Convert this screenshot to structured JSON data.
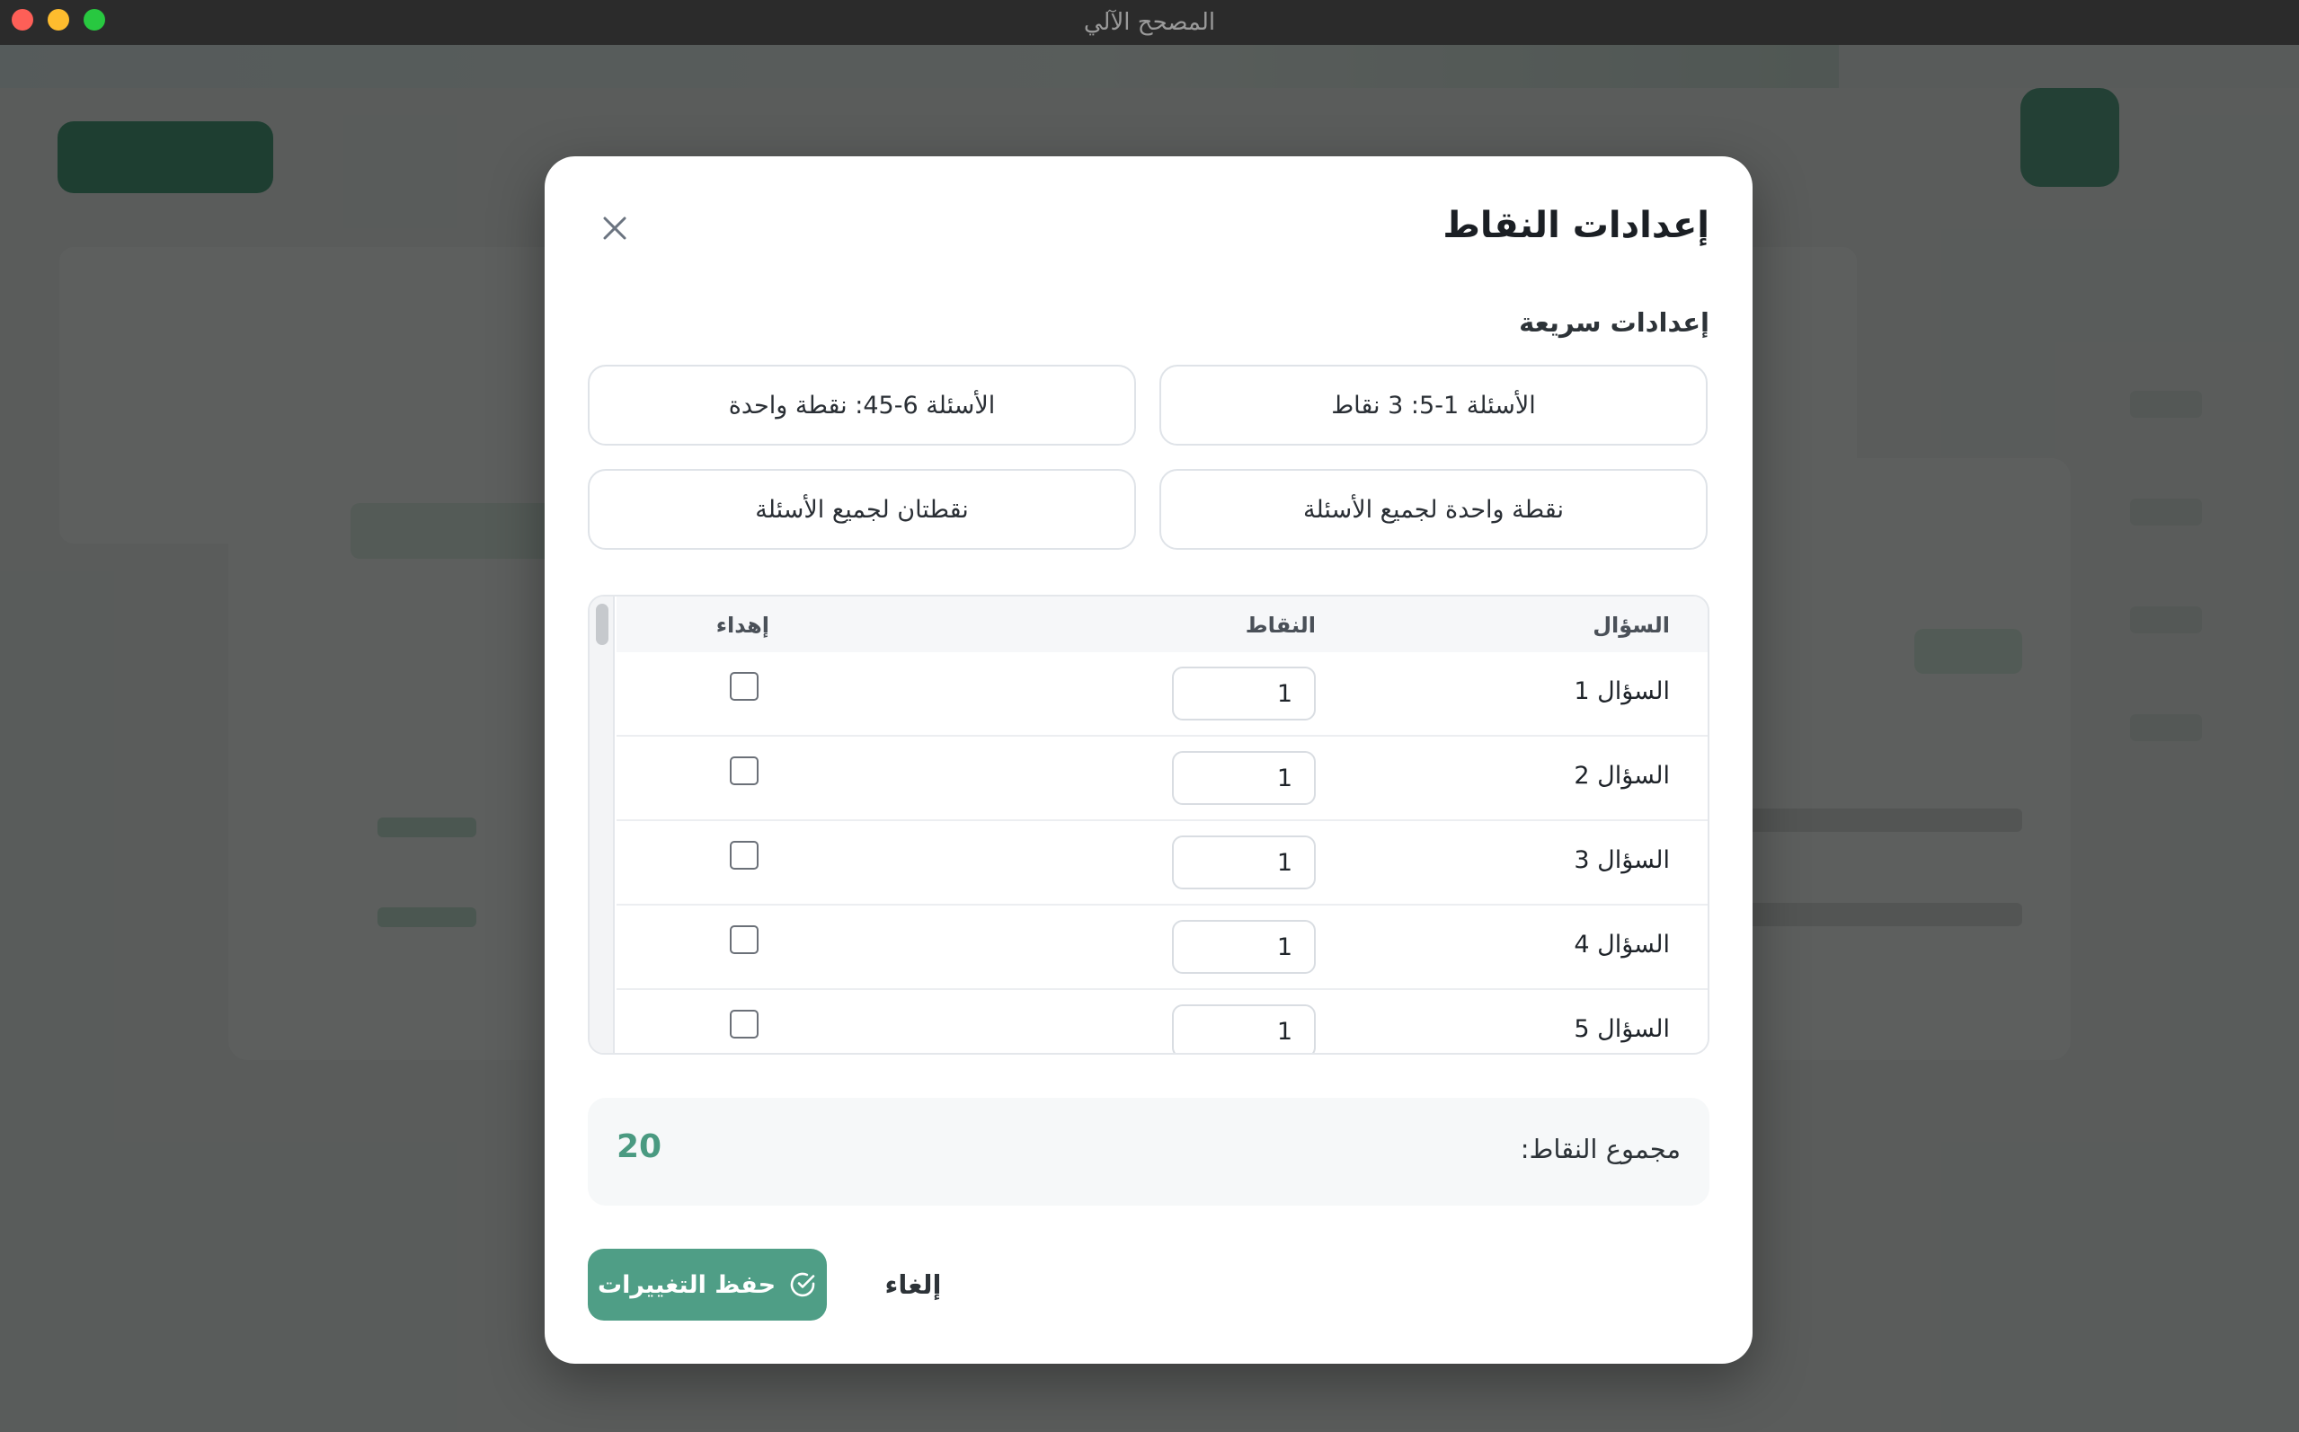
{
  "window": {
    "title": "المصحح الآلي"
  },
  "colors": {
    "accent": "#4f9e86",
    "total": "#4a9a81"
  },
  "modal": {
    "title": "إعدادات النقاط",
    "close_icon": "close-icon",
    "quick_settings": {
      "label": "إعدادات سريعة",
      "options": [
        "الأسئلة 1-5: 3 نقاط",
        "الأسئلة 6-45: نقطة واحدة",
        "نقطة واحدة لجميع الأسئلة",
        "نقطتان لجميع الأسئلة"
      ]
    },
    "table": {
      "headers": {
        "question": "السؤال",
        "points": "النقاط",
        "gift": "إهداء"
      },
      "rows": [
        {
          "question": "السؤال 1",
          "points": "1",
          "gift": false
        },
        {
          "question": "السؤال 2",
          "points": "1",
          "gift": false
        },
        {
          "question": "السؤال 3",
          "points": "1",
          "gift": false
        },
        {
          "question": "السؤال 4",
          "points": "1",
          "gift": false
        },
        {
          "question": "السؤال 5",
          "points": "1",
          "gift": false
        }
      ]
    },
    "total": {
      "label": "مجموع النقاط:",
      "value": "20"
    },
    "buttons": {
      "save": "حفظ التغييرات",
      "save_icon": "check-circle-icon",
      "cancel": "إلغاء"
    }
  }
}
